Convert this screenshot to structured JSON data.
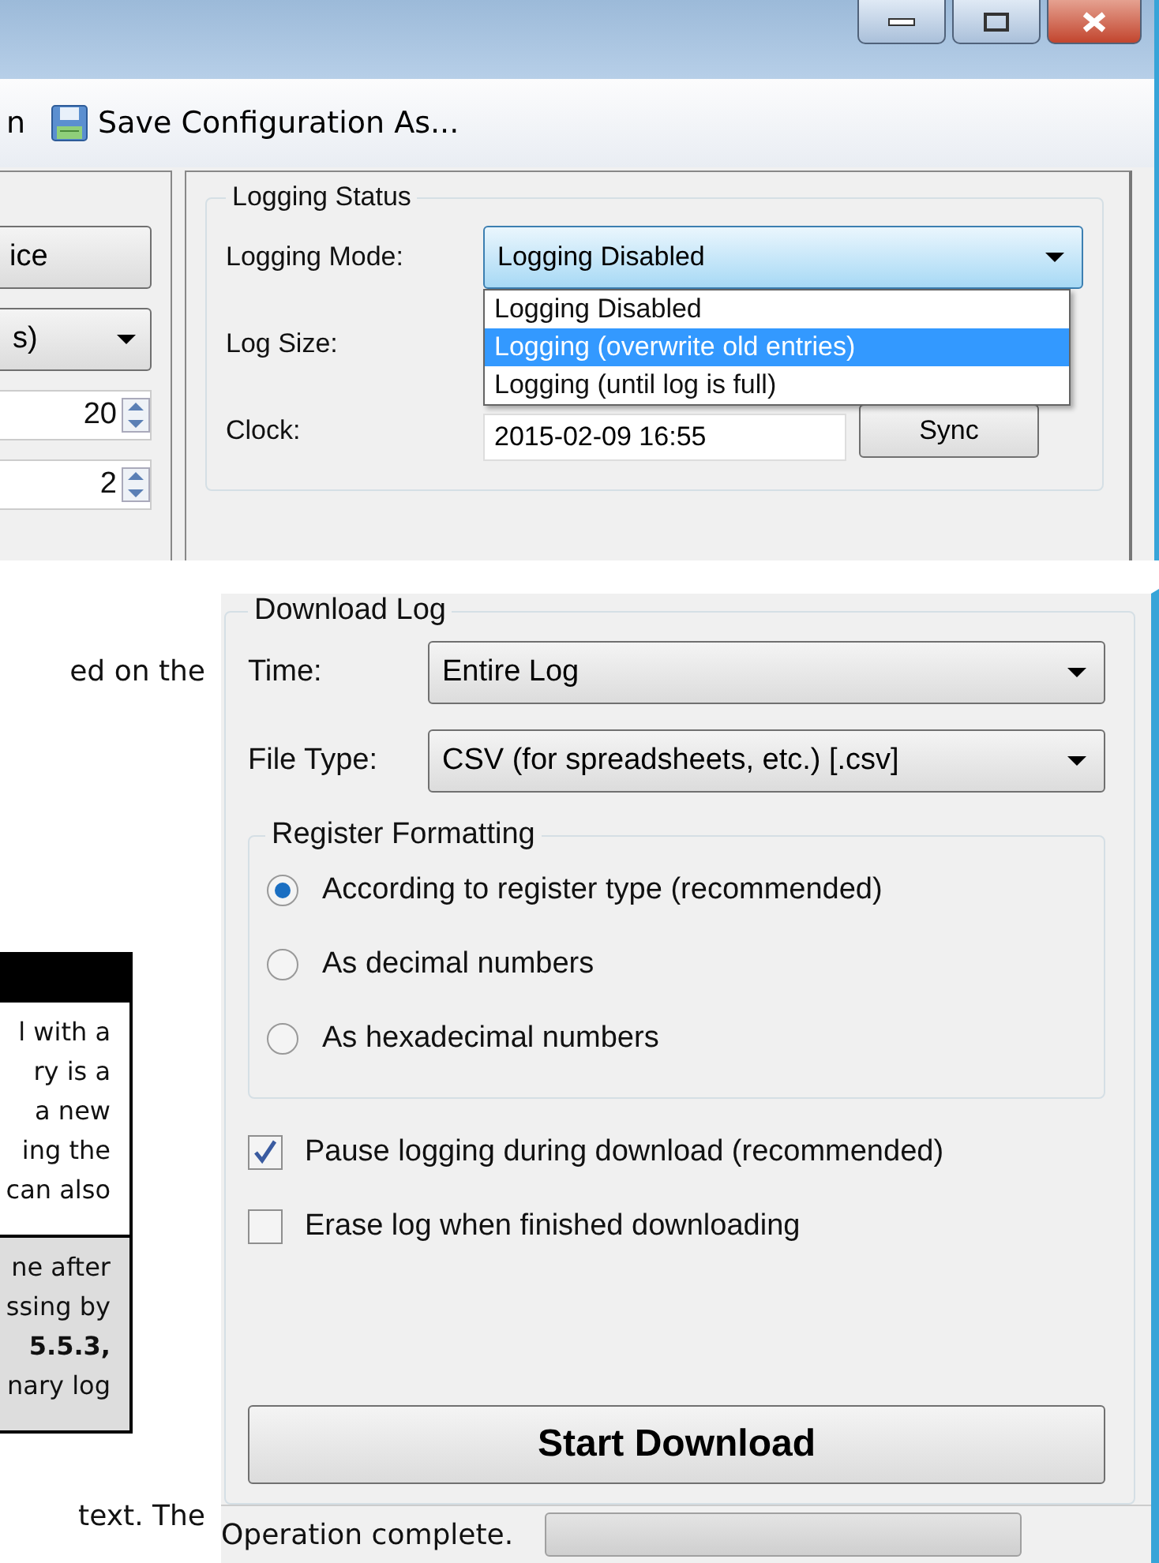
{
  "top_window": {
    "toolbar": [
      {
        "label": "n",
        "kind": "plain"
      },
      {
        "label": "Save Configuration As...",
        "kind": "save"
      }
    ],
    "left_panel": {
      "button": "ice",
      "dropdown": "s)",
      "spinners": [
        "20",
        "2"
      ]
    },
    "logging_status": {
      "title": "Logging Status",
      "mode_label": "Logging Mode:",
      "mode_value": "Logging Disabled",
      "expanded": true,
      "options": [
        {
          "label": "Logging Disabled",
          "selected": false
        },
        {
          "label": "Logging (overwrite old entries)",
          "selected": true
        },
        {
          "label": "Logging (until log is full)",
          "selected": false
        }
      ],
      "size_label": "Log Size:",
      "clock_label": "Clock:",
      "clock_value": "2015-02-09 16:55",
      "sync_button": "Sync"
    }
  },
  "document": {
    "text_top": "ed on the",
    "note_white": [
      "l with a",
      "ry is a",
      "a new",
      "ing the",
      "can also"
    ],
    "note_grey": [
      "ne after",
      "ssing by",
      "**5.5.3,**",
      "nary log"
    ],
    "text_bottom": "text. The"
  },
  "download_window": {
    "title": "Download Log",
    "time_label": "Time:",
    "time_value": "Entire Log",
    "type_label": "File Type:",
    "type_value": "CSV (for spreadsheets, etc.) [.csv]",
    "formatting": {
      "title": "Register Formatting",
      "options": [
        {
          "label": "According to register type (recommended)",
          "selected": true
        },
        {
          "label": "As decimal numbers",
          "selected": false
        },
        {
          "label": "As hexadecimal numbers",
          "selected": false
        }
      ]
    },
    "checkboxes": [
      {
        "label": "Pause logging during download (recommended)",
        "checked": true
      },
      {
        "label": "Erase log when finished downloading",
        "checked": false
      }
    ],
    "start_button": "Start Download",
    "status_bar": {
      "text": "Operation complete.",
      "level": 0
    }
  }
}
